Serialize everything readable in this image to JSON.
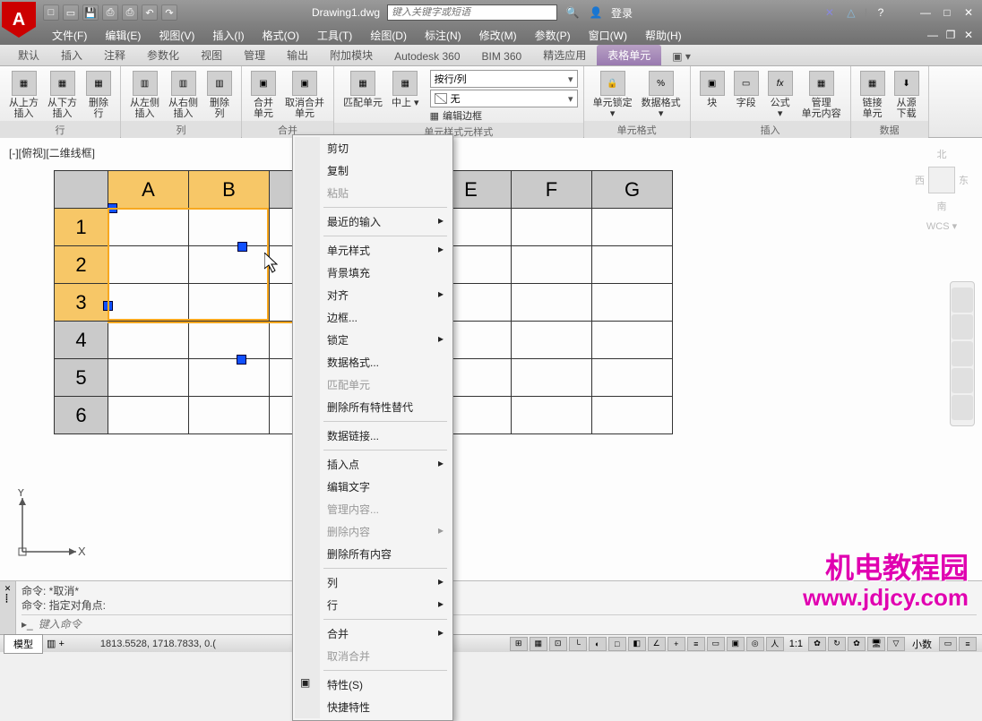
{
  "app": {
    "title": "Drawing1.dwg"
  },
  "search": {
    "placeholder": "键入关键字或短语"
  },
  "login": {
    "label": "登录"
  },
  "menubar": [
    "文件(F)",
    "编辑(E)",
    "视图(V)",
    "插入(I)",
    "格式(O)",
    "工具(T)",
    "绘图(D)",
    "标注(N)",
    "修改(M)",
    "参数(P)",
    "窗口(W)",
    "帮助(H)"
  ],
  "tabs": [
    "默认",
    "插入",
    "注释",
    "参数化",
    "视图",
    "管理",
    "输出",
    "附加模块",
    "Autodesk 360",
    "BIM 360",
    "精选应用",
    "表格单元"
  ],
  "active_tab": "表格单元",
  "ribbon": {
    "groups": [
      {
        "label": "行",
        "buttons": [
          {
            "l1": "从上方",
            "l2": "插入"
          },
          {
            "l1": "从下方",
            "l2": "插入"
          },
          {
            "l1": "删除",
            "l2": "行"
          }
        ]
      },
      {
        "label": "列",
        "buttons": [
          {
            "l1": "从左侧",
            "l2": "插入"
          },
          {
            "l1": "从右侧",
            "l2": "插入"
          },
          {
            "l1": "删除",
            "l2": "列"
          }
        ]
      },
      {
        "label": "合并",
        "buttons": [
          {
            "l1": "合并",
            "l2": "单元"
          },
          {
            "l1": "取消合并",
            "l2": "单元"
          }
        ]
      },
      {
        "label": "单元样式",
        "buttons": [
          {
            "l1": "匹配单元",
            "l2": ""
          },
          {
            "l1": "中上",
            "l2": ""
          }
        ],
        "dropdowns": [
          "按行/列",
          "无"
        ],
        "link": "编辑边框"
      },
      {
        "label": "单元格式",
        "buttons": [
          {
            "l1": "单元锁定",
            "l2": ""
          },
          {
            "l1": "数据格式",
            "l2": ""
          }
        ]
      },
      {
        "label": "插入",
        "buttons": [
          {
            "l1": "块",
            "l2": ""
          },
          {
            "l1": "字段",
            "l2": ""
          },
          {
            "l1": "公式",
            "l2": ""
          },
          {
            "l1": "管理",
            "l2": "单元内容"
          }
        ]
      },
      {
        "label": "数据",
        "buttons": [
          {
            "l1": "链接",
            "l2": "单元"
          },
          {
            "l1": "从源",
            "l2": "下载"
          }
        ]
      }
    ]
  },
  "view_label": "[-][俯视][二维线框]",
  "table": {
    "cols": [
      "A",
      "B",
      "",
      "",
      "E",
      "F",
      "G"
    ],
    "rows": [
      "1",
      "2",
      "3",
      "4",
      "5",
      "6"
    ]
  },
  "viewcube": {
    "n": "北",
    "s": "南",
    "w": "西",
    "e": "东",
    "wcs": "WCS ▾"
  },
  "context_menu": [
    {
      "label": "剪切",
      "type": "item"
    },
    {
      "label": "复制",
      "type": "item"
    },
    {
      "label": "粘贴",
      "type": "item",
      "disabled": true
    },
    {
      "type": "sep"
    },
    {
      "label": "最近的输入",
      "type": "sub"
    },
    {
      "type": "sep"
    },
    {
      "label": "单元样式",
      "type": "sub"
    },
    {
      "label": "背景填充",
      "type": "item"
    },
    {
      "label": "对齐",
      "type": "sub"
    },
    {
      "label": "边框...",
      "type": "item"
    },
    {
      "label": "锁定",
      "type": "sub"
    },
    {
      "label": "数据格式...",
      "type": "item"
    },
    {
      "label": "匹配单元",
      "type": "item",
      "disabled": true
    },
    {
      "label": "删除所有特性替代",
      "type": "item"
    },
    {
      "type": "sep"
    },
    {
      "label": "数据链接...",
      "type": "item"
    },
    {
      "type": "sep"
    },
    {
      "label": "插入点",
      "type": "sub"
    },
    {
      "label": "编辑文字",
      "type": "item"
    },
    {
      "label": "管理内容...",
      "type": "item",
      "disabled": true
    },
    {
      "label": "删除内容",
      "type": "sub",
      "disabled": true
    },
    {
      "label": "删除所有内容",
      "type": "item"
    },
    {
      "type": "sep"
    },
    {
      "label": "列",
      "type": "sub"
    },
    {
      "label": "行",
      "type": "sub"
    },
    {
      "type": "sep"
    },
    {
      "label": "合并",
      "type": "sub"
    },
    {
      "label": "取消合并",
      "type": "item",
      "disabled": true
    },
    {
      "type": "sep"
    },
    {
      "label": "特性(S)",
      "type": "item",
      "icon": "▣"
    },
    {
      "label": "快捷特性",
      "type": "item"
    }
  ],
  "cmd": {
    "history": [
      "命令: *取消*",
      "命令: 指定对角点:"
    ],
    "placeholder": "键入命令",
    "prompt_icon": "▸_"
  },
  "status": {
    "tab": "模型",
    "coords": "1813.5528, 1718.7833, 0.(",
    "ratio": "1:1",
    "mode": "小数"
  },
  "watermark": {
    "text": "机电教程园",
    "url": "www.jdjcy.com"
  }
}
